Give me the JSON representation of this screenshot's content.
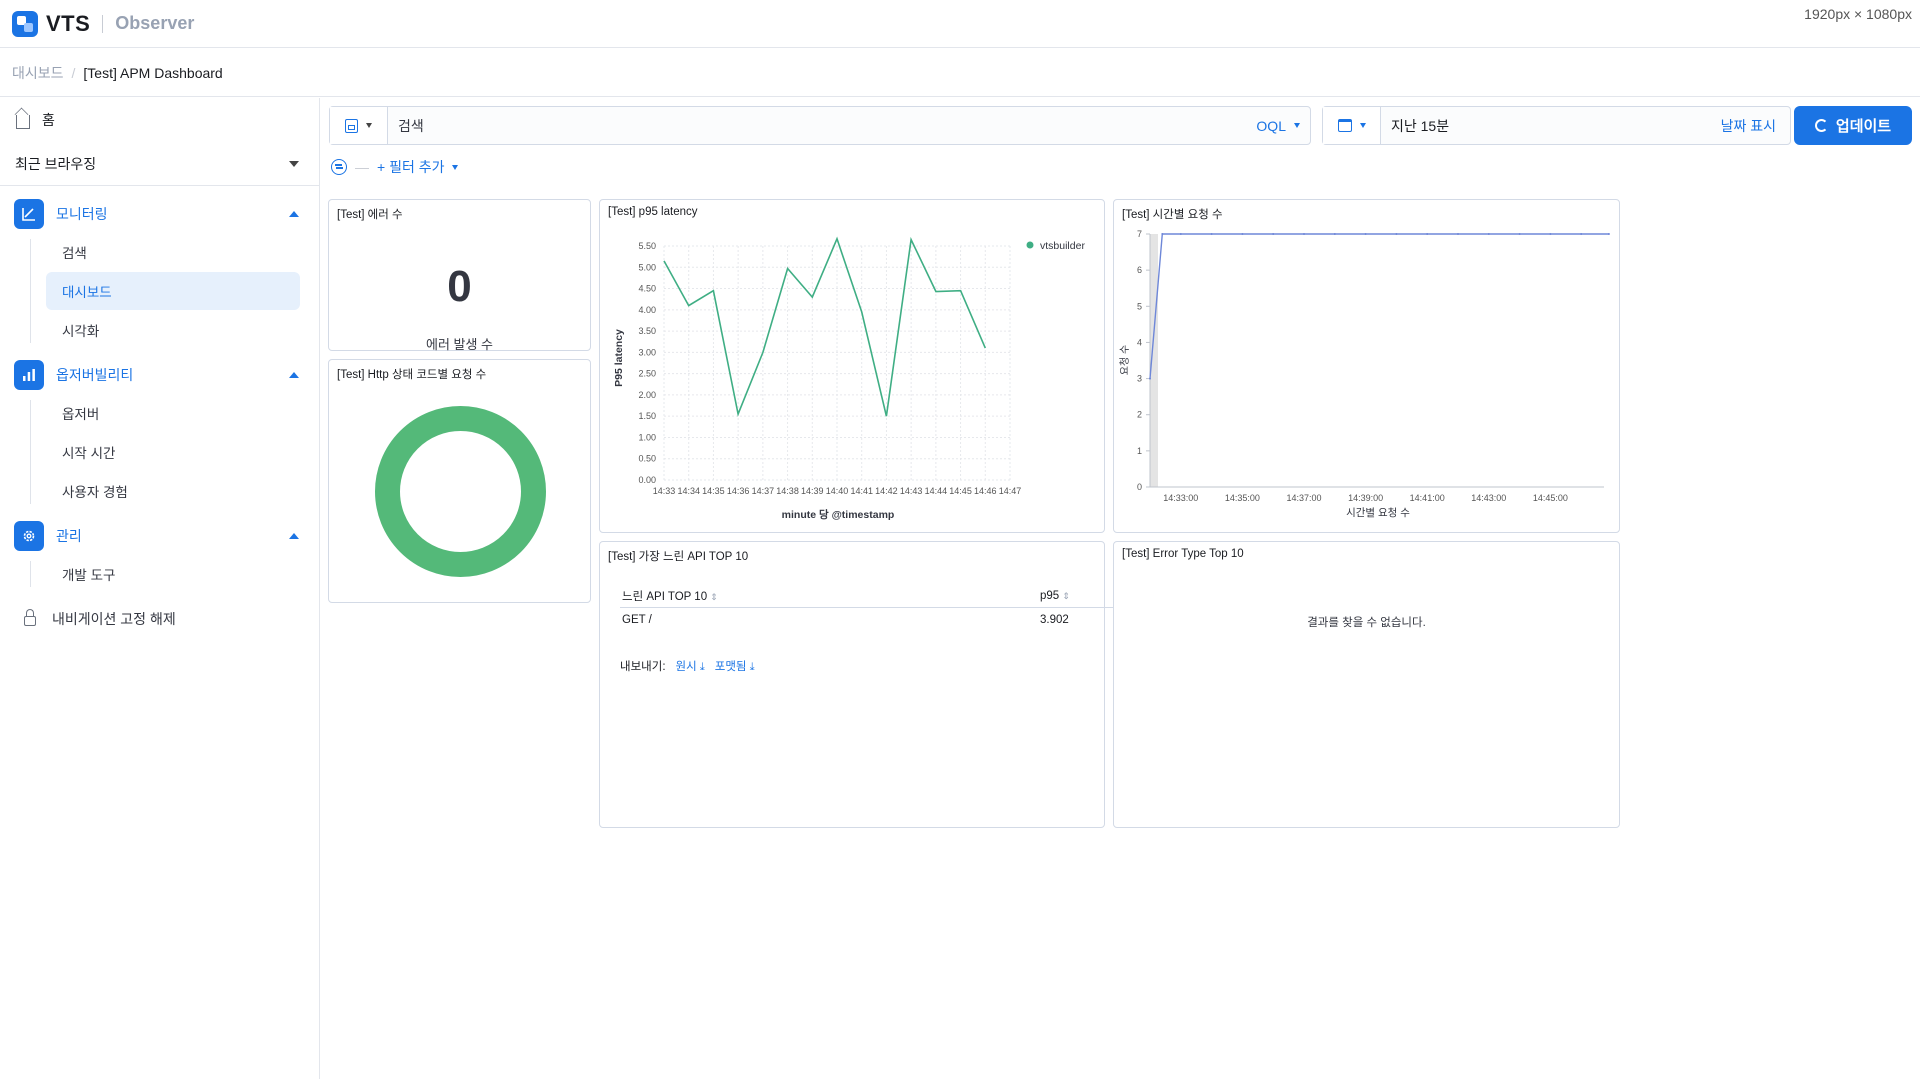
{
  "header": {
    "brand": "VTS",
    "product": "Observer",
    "dimensions": "1920px × 1080px"
  },
  "breadcrumb": {
    "root": "대시보드",
    "separator": "/",
    "current": "[Test] APM Dashboard"
  },
  "sidebar": {
    "home": "홈",
    "recent": "최근 브라우징",
    "groups": [
      {
        "label": "모니터링",
        "icon": "monitoring-icon",
        "items": [
          "검색",
          "대시보드",
          "시각화"
        ],
        "active": "대시보드"
      },
      {
        "label": "옵저버빌리티",
        "icon": "bar-chart-icon",
        "items": [
          "옵저버",
          "시작 시간",
          "사용자 경험"
        ]
      },
      {
        "label": "관리",
        "icon": "gear-icon",
        "items": [
          "개발 도구"
        ]
      }
    ],
    "unlock": "내비게이션 고정 해제"
  },
  "query": {
    "placeholder": "검색",
    "language": "OQL",
    "date_range": "지난 15분",
    "date_show": "날짜 표시",
    "update": "업데이트",
    "add_filter": "+ 필터 추가"
  },
  "panels": {
    "errors": {
      "title": "[Test] 에러 수",
      "value": "0",
      "label": "에러 발생 수"
    },
    "http": {
      "title": "[Test] Http 상태 코드별 요청 수",
      "ring_color": "#54b979"
    },
    "p95": {
      "title": "[Test] p95 latency",
      "ylabel": "P95 latency",
      "xlabel": "minute 당 @timestamp",
      "legend": "vtsbuilder",
      "color": "#3fae84"
    },
    "requests": {
      "title": "[Test] 시간별 요청 수",
      "ylabel": "요청 수",
      "xlabel": "시간별 요청 수",
      "color": "#6e87d8"
    },
    "slow_api": {
      "title": "[Test] 가장 느린 API TOP 10",
      "col1": "느린 API TOP 10",
      "col2": "p95",
      "rows": [
        {
          "api": "GET /",
          "p95": "3.902"
        }
      ],
      "export_label": "내보내기:",
      "export_raw": "원시",
      "export_formatted": "포맷됨"
    },
    "error_type": {
      "title": "[Test] Error Type Top 10",
      "empty": "결과를 찾을 수 없습니다."
    }
  },
  "chart_data": [
    {
      "type": "line",
      "title": "[Test] p95 latency",
      "xlabel": "minute 당 @timestamp",
      "ylabel": "P95 latency",
      "categories": [
        "14:33",
        "14:34",
        "14:35",
        "14:36",
        "14:37",
        "14:38",
        "14:39",
        "14:40",
        "14:41",
        "14:42",
        "14:43",
        "14:44",
        "14:45",
        "14:46",
        "14:47"
      ],
      "series": [
        {
          "name": "vtsbuilder",
          "values": [
            5.15,
            4.1,
            4.45,
            1.55,
            3.0,
            4.97,
            4.3,
            5.67,
            3.95,
            1.5,
            5.65,
            4.43,
            4.45,
            3.1,
            null
          ]
        }
      ],
      "ylim": [
        0,
        5.5
      ],
      "yticks": [
        "0.00",
        "0.50",
        "1.00",
        "1.50",
        "2.00",
        "2.50",
        "3.00",
        "3.50",
        "4.00",
        "4.50",
        "5.00",
        "5.50"
      ],
      "grid": true,
      "legend": "top-right"
    },
    {
      "type": "line",
      "title": "[Test] 시간별 요청 수",
      "xlabel": "시간별 요청 수",
      "ylabel": "요청 수",
      "xticks": [
        "14:33:00",
        "14:35:00",
        "14:37:00",
        "14:39:00",
        "14:41:00",
        "14:43:00",
        "14:45:00"
      ],
      "x_minutes": [
        32.0,
        32.4,
        33,
        34,
        35,
        36,
        37,
        38,
        39,
        40,
        41,
        42,
        43,
        44,
        45,
        46,
        46.9
      ],
      "values": [
        3,
        7,
        7,
        7,
        7,
        7,
        7,
        7,
        7,
        7,
        7,
        7,
        7,
        7,
        7,
        7,
        7
      ],
      "ylim": [
        0,
        7
      ],
      "yticks": [
        "0",
        "1",
        "2",
        "3",
        "4",
        "5",
        "6",
        "7"
      ],
      "grid": false
    },
    {
      "type": "pie",
      "title": "[Test] Http 상태 코드별 요청 수",
      "slices": [
        {
          "value": 100,
          "color": "#54b979"
        }
      ],
      "donut": true
    }
  ]
}
